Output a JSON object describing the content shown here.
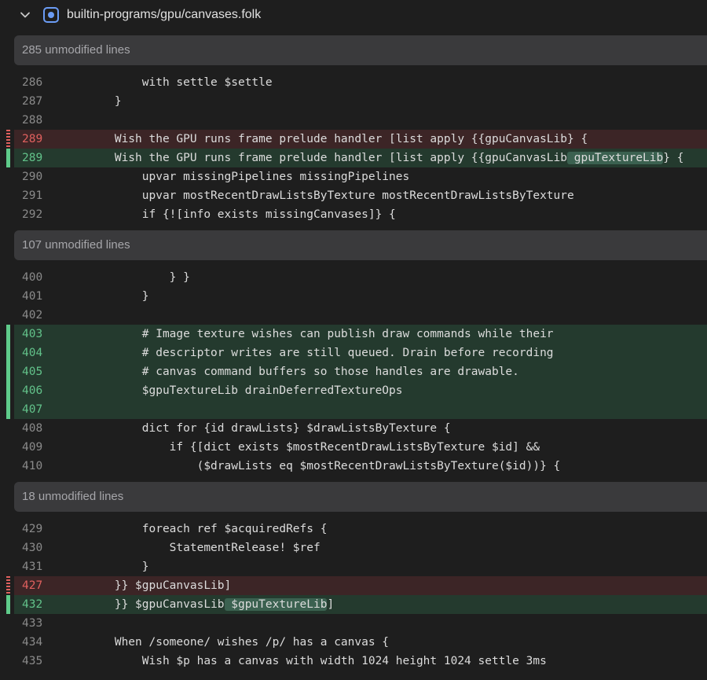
{
  "file": {
    "path": "builtin-programs/gpu/canvases.folk"
  },
  "hunks": [
    {
      "kind": "fold",
      "label": "285 unmodified lines"
    },
    {
      "kind": "ctx",
      "num": "286",
      "code": "            with settle $settle"
    },
    {
      "kind": "ctx",
      "num": "287",
      "code": "        }"
    },
    {
      "kind": "ctx",
      "num": "288",
      "code": ""
    },
    {
      "kind": "del",
      "num": "289",
      "code": "        Wish the GPU runs frame prelude handler [list apply {{gpuCanvasLib} {"
    },
    {
      "kind": "add",
      "num": "289",
      "pre": "        Wish the GPU runs frame prelude handler [list apply {{gpuCanvasLib",
      "hl": " gpuTextureLib",
      "post": "} {"
    },
    {
      "kind": "ctx",
      "num": "290",
      "code": "            upvar missingPipelines missingPipelines"
    },
    {
      "kind": "ctx",
      "num": "291",
      "code": "            upvar mostRecentDrawListsByTexture mostRecentDrawListsByTexture"
    },
    {
      "kind": "ctx",
      "num": "292",
      "code": "            if {![info exists missingCanvases]} {"
    },
    {
      "kind": "fold",
      "label": "107 unmodified lines"
    },
    {
      "kind": "ctx",
      "num": "400",
      "code": "                } }"
    },
    {
      "kind": "ctx",
      "num": "401",
      "code": "            }"
    },
    {
      "kind": "ctx",
      "num": "402",
      "code": ""
    },
    {
      "kind": "add",
      "num": "403",
      "code": "            # Image texture wishes can publish draw commands while their"
    },
    {
      "kind": "add",
      "num": "404",
      "code": "            # descriptor writes are still queued. Drain before recording"
    },
    {
      "kind": "add",
      "num": "405",
      "code": "            # canvas command buffers so those handles are drawable."
    },
    {
      "kind": "add",
      "num": "406",
      "code": "            $gpuTextureLib drainDeferredTextureOps"
    },
    {
      "kind": "add",
      "num": "407",
      "code": ""
    },
    {
      "kind": "ctx",
      "num": "408",
      "code": "            dict for {id drawLists} $drawListsByTexture {"
    },
    {
      "kind": "ctx",
      "num": "409",
      "code": "                if {[dict exists $mostRecentDrawListsByTexture $id] &&"
    },
    {
      "kind": "ctx",
      "num": "410",
      "code": "                    ($drawLists eq $mostRecentDrawListsByTexture($id))} {"
    },
    {
      "kind": "fold",
      "label": "18 unmodified lines"
    },
    {
      "kind": "ctx",
      "num": "429",
      "code": "            foreach ref $acquiredRefs {"
    },
    {
      "kind": "ctx",
      "num": "430",
      "code": "                StatementRelease! $ref"
    },
    {
      "kind": "ctx",
      "num": "431",
      "code": "            }"
    },
    {
      "kind": "del",
      "num": "427",
      "code": "        }} $gpuCanvasLib]"
    },
    {
      "kind": "add",
      "num": "432",
      "pre": "        }} $gpuCanvasLib",
      "hl": " $gpuTextureLib",
      "post": "]"
    },
    {
      "kind": "ctx",
      "num": "433",
      "code": ""
    },
    {
      "kind": "ctx",
      "num": "434",
      "code": "        When /someone/ wishes /p/ has a canvas {"
    },
    {
      "kind": "ctx",
      "num": "435",
      "code": "            Wish $p has a canvas with width 1024 height 1024 settle 3ms"
    }
  ],
  "colors": {
    "added_bg": "#243a2e",
    "removed_bg": "#3c2526",
    "added_marker": "#5fcb8a",
    "removed_marker": "#e0605e"
  }
}
